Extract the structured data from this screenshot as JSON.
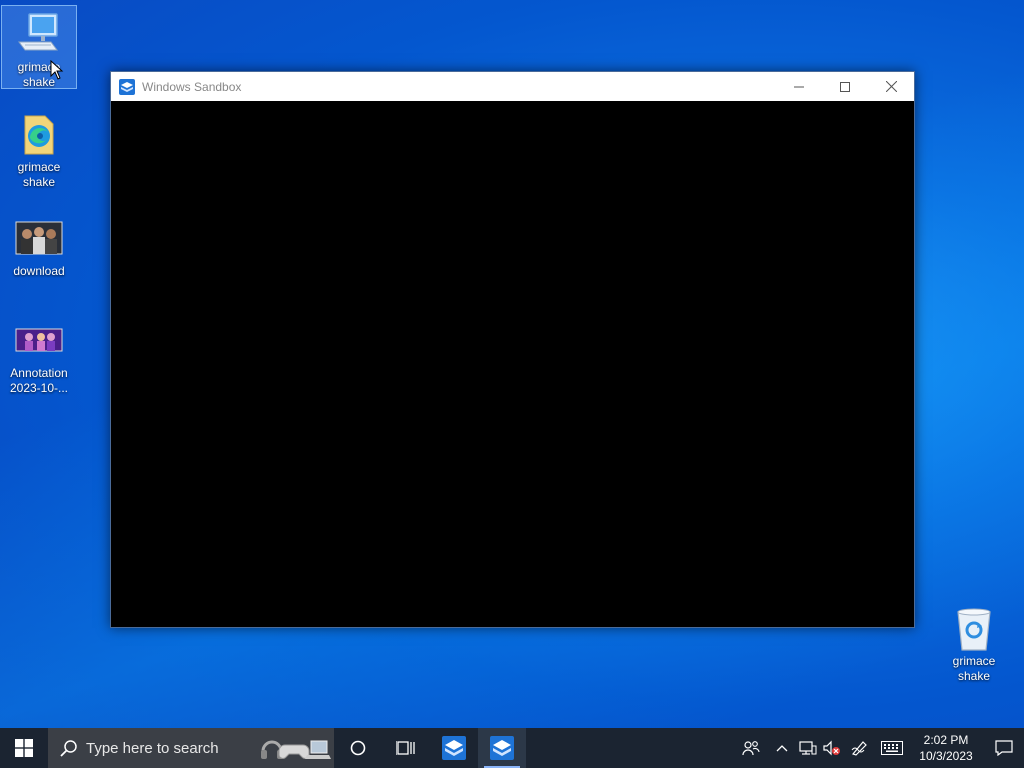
{
  "desktop": {
    "icons": [
      {
        "label_line1": "grimace",
        "label_line2": "shake"
      },
      {
        "label_line1": "grimace",
        "label_line2": "shake"
      },
      {
        "label_line1": "download",
        "label_line2": ""
      },
      {
        "label_line1": "Annotation",
        "label_line2": "2023-10-..."
      },
      {
        "label_line1": "grimace",
        "label_line2": "shake"
      }
    ]
  },
  "window": {
    "title": "Windows Sandbox"
  },
  "taskbar": {
    "search_placeholder": "Type here to search",
    "clock_time": "2:02 PM",
    "clock_date": "10/3/2023"
  },
  "colors": {
    "taskbar_bg": "#1b2431",
    "sandbox_blue": "#1e73d6",
    "window_content": "#000000"
  }
}
